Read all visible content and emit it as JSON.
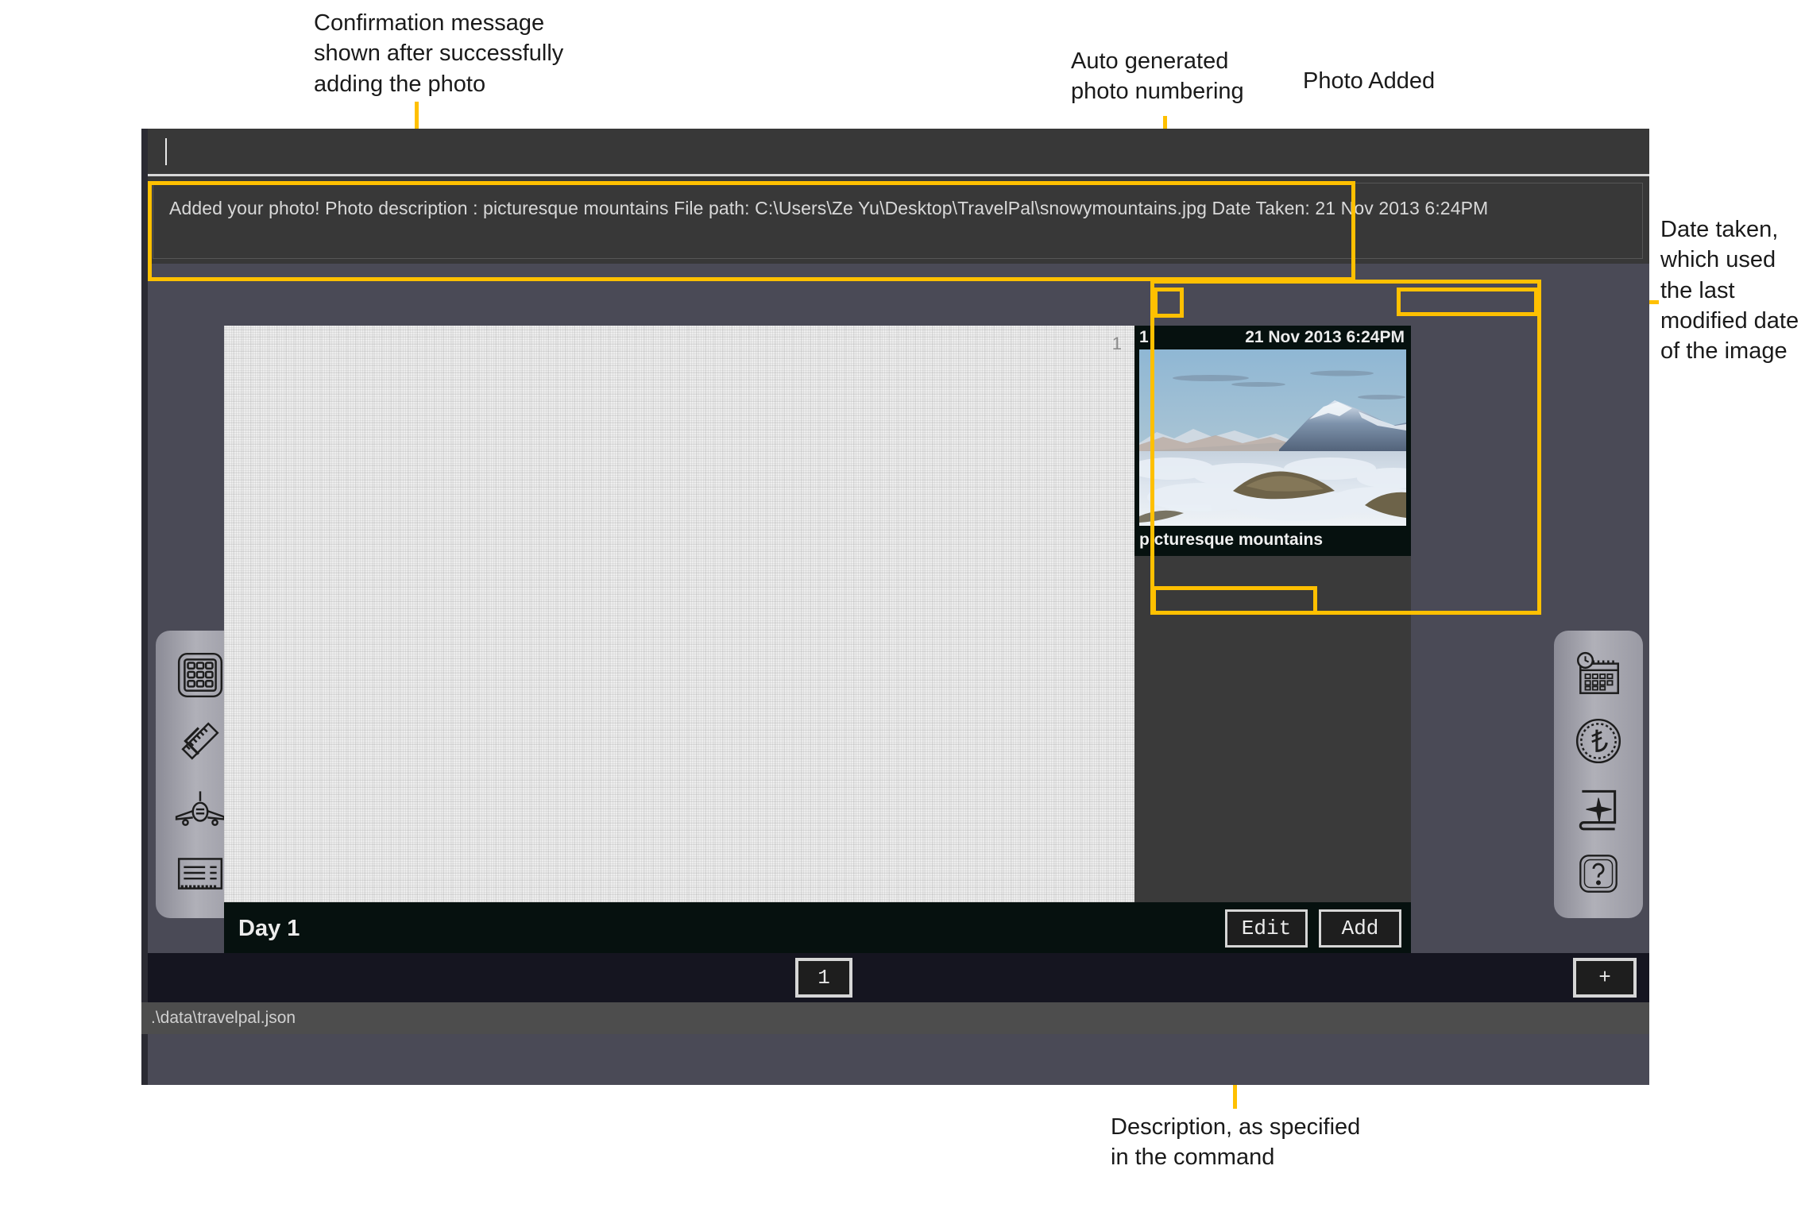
{
  "annotations": {
    "confirmation": "Confirmation message\nshown after successfully\nadding the photo",
    "numbering": "Auto generated\nphoto numbering",
    "photo_added": "Photo Added",
    "date_taken": "Date taken,\nwhich used\nthe last\nmodified date\nof the image",
    "description": "Description, as specified\nin the command"
  },
  "console": {
    "command_value": "",
    "command_placeholder": "",
    "output_message": "Added your photo! Photo description : picturesque mountains File path: C:\\Users\\Ze Yu\\Desktop\\TravelPal\\snowymountains.jpg Date Taken: 21 Nov 2013 6:24PM"
  },
  "sidebar_left": {
    "items": [
      {
        "icon": "calculator-icon",
        "label": "Calculator"
      },
      {
        "icon": "ruler-icon",
        "label": "Ruler"
      },
      {
        "icon": "airplane-icon",
        "label": "Flights"
      },
      {
        "icon": "ticket-icon",
        "label": "Itinerary"
      }
    ]
  },
  "sidebar_right": {
    "items": [
      {
        "icon": "calendar-clock-icon",
        "label": "Schedule"
      },
      {
        "icon": "currency-coin-icon",
        "label": "Currency"
      },
      {
        "icon": "travel-book-icon",
        "label": "Travel Book"
      },
      {
        "icon": "help-icon",
        "label": "Help"
      }
    ]
  },
  "page": {
    "page_number_faint": "1"
  },
  "photo": {
    "index": "1",
    "date_taken": "21 Nov 2013 6:24PM",
    "caption": "picturesque mountains"
  },
  "day_bar": {
    "title": "Day 1",
    "edit_label": "Edit",
    "add_label": "Add"
  },
  "pager": {
    "page_1": "1",
    "add_page": "+"
  },
  "status": {
    "file_path": ".\\data\\travelpal.json"
  },
  "colors": {
    "highlight": "#FFC000",
    "panel_dark": "#3A3A3A",
    "workspace": "#4A4A56",
    "card_black": "#06110F"
  }
}
